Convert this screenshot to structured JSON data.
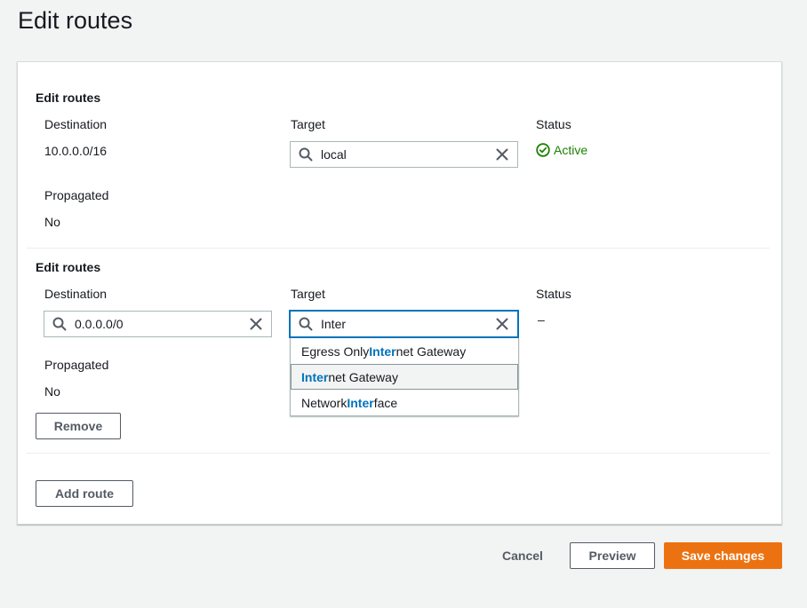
{
  "page": {
    "title": "Edit routes"
  },
  "routes": [
    {
      "section_title": "Edit routes",
      "destination_label": "Destination",
      "destination_value": "10.0.0.0/16",
      "target_label": "Target",
      "target_value": "local",
      "status_label": "Status",
      "status_value": "Active",
      "propagated_label": "Propagated",
      "propagated_value": "No"
    },
    {
      "section_title": "Edit routes",
      "destination_label": "Destination",
      "destination_value": "0.0.0.0/0",
      "target_label": "Target",
      "target_value": "Inter",
      "status_label": "Status",
      "status_value": "–",
      "propagated_label": "Propagated",
      "propagated_value": "No",
      "remove_label": "Remove"
    }
  ],
  "dropdown": {
    "query": "Inter",
    "options": [
      {
        "before": "Egress Only ",
        "match": "Inter",
        "after": "net Gateway"
      },
      {
        "before": "",
        "match": "Inter",
        "after": "net Gateway"
      },
      {
        "before": "Network ",
        "match": "Inter",
        "after": "face"
      }
    ],
    "highlighted_index": 1
  },
  "actions": {
    "add_route": "Add route",
    "cancel": "Cancel",
    "preview": "Preview",
    "save": "Save changes"
  },
  "colors": {
    "accent": "#0073bb",
    "primary": "#ec7211",
    "success": "#1d8102"
  },
  "icons": {
    "search": "search-icon",
    "clear": "close-icon",
    "status": "check-circle-icon"
  }
}
